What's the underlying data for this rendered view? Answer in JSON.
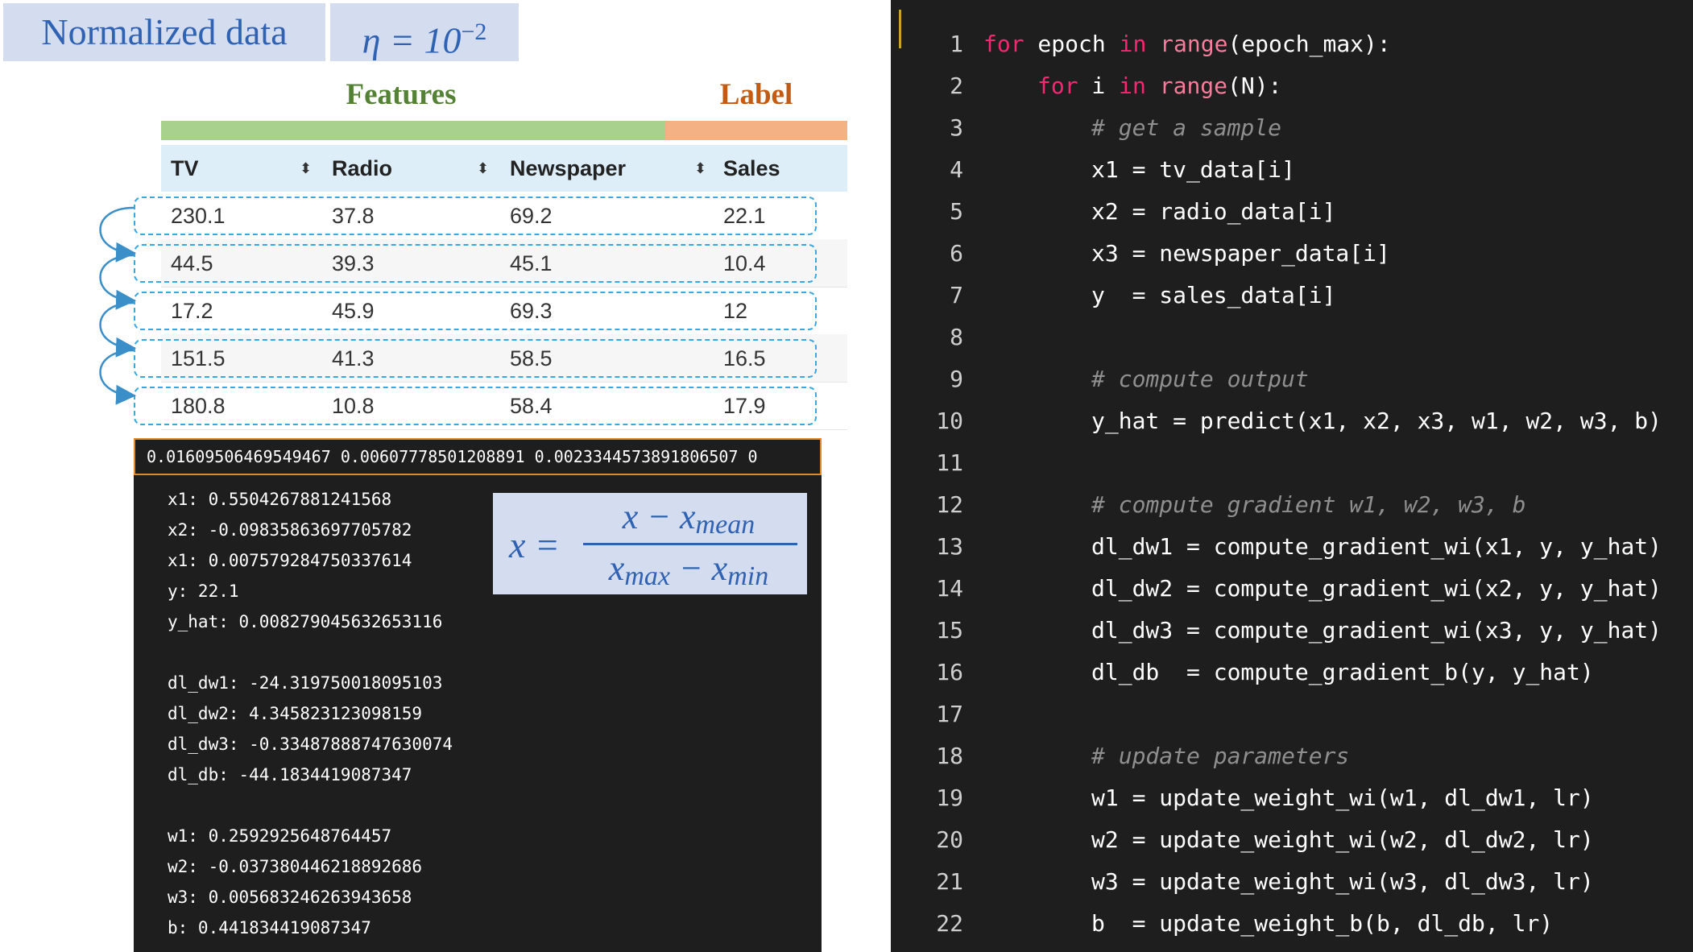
{
  "title": {
    "normalized": "Normalized data",
    "eta_base": "η = 10",
    "eta_exp": "−2"
  },
  "groups": {
    "features": "Features",
    "label": "Label"
  },
  "table": {
    "headers": [
      "TV",
      "Radio",
      "Newspaper",
      "Sales"
    ],
    "rows": [
      [
        "230.1",
        "37.8",
        "69.2",
        "22.1"
      ],
      [
        "44.5",
        "39.3",
        "45.1",
        "10.4"
      ],
      [
        "17.2",
        "45.9",
        "69.3",
        "12"
      ],
      [
        "151.5",
        "41.3",
        "58.5",
        "16.5"
      ],
      [
        "180.8",
        "10.8",
        "58.4",
        "17.9"
      ]
    ]
  },
  "params_line": "0.01609506469549467 0.00607778501208891 0.0023344573891806507 0",
  "console": {
    "group1": [
      "x1: 0.5504267881241568",
      "x2: -0.09835863697705782",
      "x1: 0.007579284750337614",
      "y: 22.1",
      "y_hat: 0.008279045632653116"
    ],
    "group2": [
      "dl_dw1: -24.319750018095103",
      "dl_dw2: 4.345823123098159",
      "dl_dw3: -0.33487888747630074",
      "dl_db: -44.1834419087347"
    ],
    "group3": [
      "w1: 0.2592925648764457",
      "w2: -0.037380446218892686",
      "w3: 0.005683246263943658",
      "b: 0.441834419087347"
    ]
  },
  "formula": {
    "lhs": "x =",
    "num_x": "x − x",
    "num_sub": "mean",
    "den_x1": "x",
    "den_sub1": "max",
    "den_mid": " − x",
    "den_sub2": "min"
  },
  "code": {
    "line_numbers": [
      "1",
      "2",
      "3",
      "4",
      "5",
      "6",
      "7",
      "8",
      "9",
      "10",
      "11",
      "12",
      "13",
      "14",
      "15",
      "16",
      "17",
      "18",
      "19",
      "20",
      "21",
      "22"
    ],
    "l1": {
      "kw1": "for",
      "a": " epoch ",
      "kw2": "in",
      "sp": " ",
      "fn": "range",
      "b": "(epoch_max):"
    },
    "l2": {
      "kw1": "for",
      "a": " i ",
      "kw2": "in",
      "sp": " ",
      "fn": "range",
      "b": "(N):"
    },
    "l3": "# get a sample",
    "l4": "x1 = tv_data[i]",
    "l5": "x2 = radio_data[i]",
    "l6": "x3 = newspaper_data[i]",
    "l7": "y  = sales_data[i]",
    "l9": "# compute output",
    "l10": "y_hat = predict(x1, x2, x3, w1, w2, w3, b)",
    "l12": "# compute gradient w1, w2, w3, b",
    "l13": "dl_dw1 = compute_gradient_wi(x1, y, y_hat)",
    "l14": "dl_dw2 = compute_gradient_wi(x2, y, y_hat)",
    "l15": "dl_dw3 = compute_gradient_wi(x3, y, y_hat)",
    "l16": "dl_db  = compute_gradient_b(y, y_hat)",
    "l18": "# update parameters",
    "l19": "w1 = update_weight_wi(w1, dl_dw1, lr)",
    "l20": "w2 = update_weight_wi(w2, dl_dw2, lr)",
    "l21": "w3 = update_weight_wi(w3, dl_dw3, lr)",
    "l22": "b  = update_weight_b(b, dl_db, lr)"
  },
  "colors": {
    "features": "#548235",
    "label": "#c55a11",
    "title_blue": "#2f62b3",
    "dash": "#39a7e0",
    "accent_border": "#e0892a"
  }
}
